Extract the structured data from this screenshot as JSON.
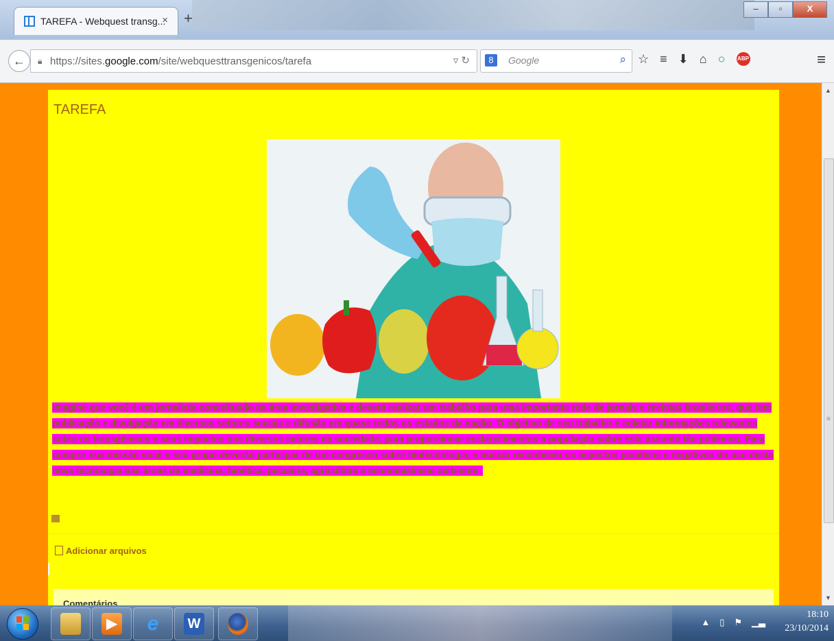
{
  "browser": {
    "tab_title": "TAREFA - Webquest transg...",
    "tab_close": "×",
    "new_tab": "+",
    "win_minimize": "–",
    "win_maximize": "▫",
    "win_close": "X",
    "url_prefix": "https://sites.",
    "url_domain": "google.com",
    "url_path": "/site/webquesttransgenicos/tarefa",
    "search_placeholder": "Google",
    "search_engine_icon": "8",
    "abp_label": "ABP"
  },
  "page": {
    "title": "TAREFA",
    "hero_image_icon": "scientist-with-fruits-image",
    "description": "Imagine que você é um jornalista conceituado na área investigativa e deverá realizar um trabalho para uma importante rede de jornais e revistas brasileiros, que tem publicação e divulgação em diversos setores sociais e difusão em quase todos os estados da nação. O objetivo de seu trabalho é coletar informações  relevantes sobre  os transgênicos e seus impactos nos diversos setores da sociedade, para proporcionar esclarecimentos à população sobre este assunto tão polêmico. Para cumprir sua missão você e seu grupo deverão participar de um congresso sobre biotecnologia, e buscar reconhecer os aspectos positivos e negativos do uso desta nova tecnologia nas áreas da medicina, bioética, pecuária, agricultura e economia/meio ambiente .",
    "add_files_label": "Adicionar arquivos",
    "comments_label": "Comentários"
  },
  "taskbar": {
    "clock_time": "18:10",
    "clock_date": "23/10/2014",
    "apps": [
      "explorer-icon",
      "media-player-icon",
      "internet-explorer-icon",
      "word-icon",
      "firefox-icon"
    ],
    "word_glyph": "W",
    "ie_glyph": "e"
  },
  "colors": {
    "page_background": "#ff8c00",
    "content_background": "#ffff00",
    "highlight": "#ff00ff",
    "title_text": "#a0621a"
  }
}
